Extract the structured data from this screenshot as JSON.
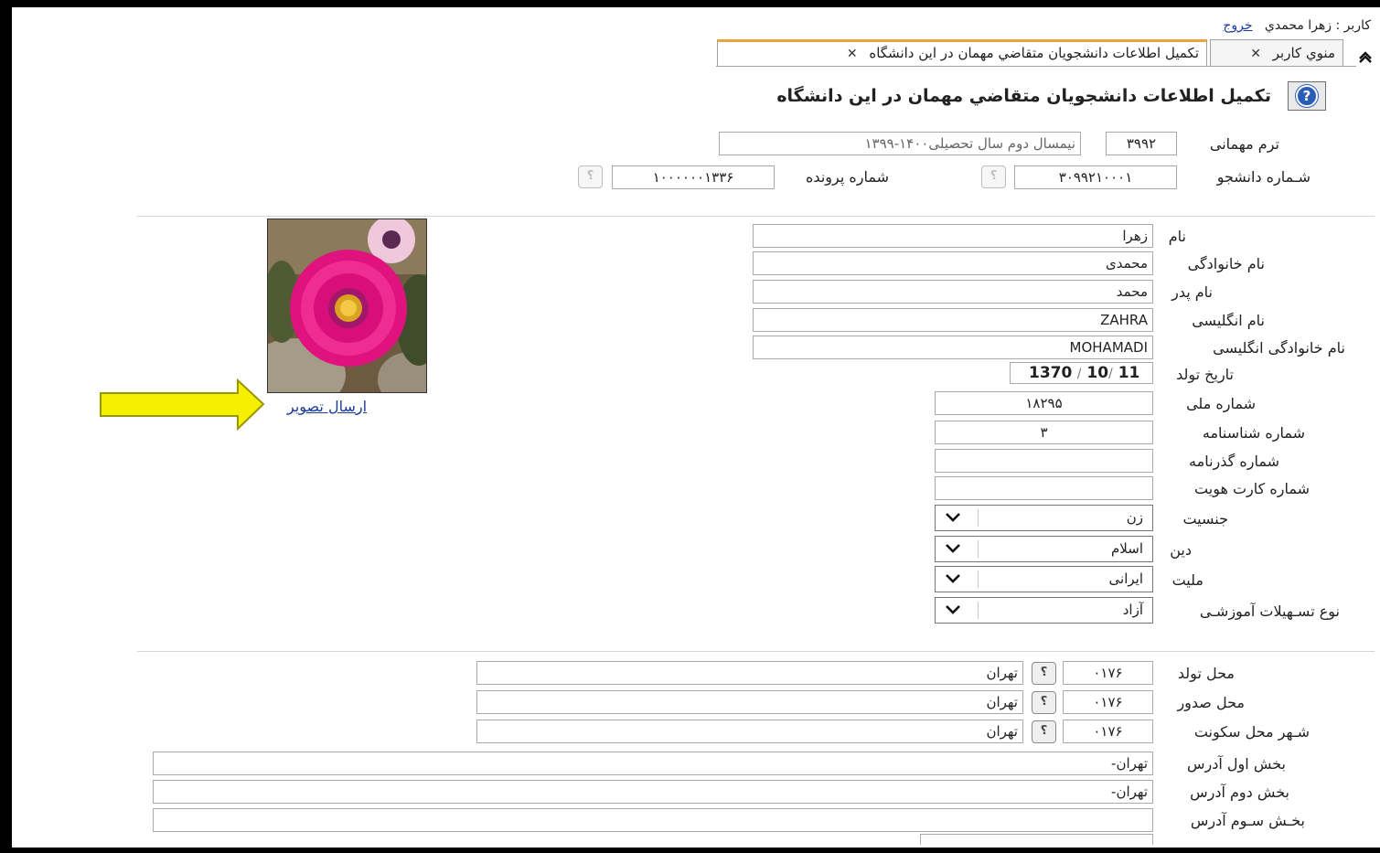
{
  "user": {
    "label": "كاربر : زهرا محمدي",
    "logout": "خروج"
  },
  "tabs": [
    {
      "label": "منوي كاربر",
      "close": "✕"
    },
    {
      "label": "تكميل اطلاعات دانشجويان متقاضي مهمان در اين دانشگاه",
      "close": "✕"
    }
  ],
  "page_title": "تكميل اطلاعات دانشجويان متقاضي مهمان در اين دانشگاه",
  "help_icon": "?",
  "term": {
    "label": "ترم مهمانی",
    "code": "۳۹۹۲",
    "description": "نیمسال  دوم سال تحصیلی۱۴۰۰-۱۳۹۹"
  },
  "student": {
    "label": "شـماره دانشجو",
    "value": "۳۰۹۹۲۱۰۰۰۱"
  },
  "file": {
    "label": "شماره پرونده",
    "value": "۱۰۰۰۰۰۰۱۳۳۶"
  },
  "lookup_glyph": "؟",
  "personal": {
    "first_name": {
      "label": "نام",
      "value": "زهرا"
    },
    "last_name": {
      "label": "نام خانوادگی",
      "value": "محمدی"
    },
    "father_name": {
      "label": "نام پدر",
      "value": "محمد"
    },
    "english_name": {
      "label": "نام انگلیسی",
      "value": "ZAHRA"
    },
    "english_last_name": {
      "label": "نام خانوادگی انگلیسی",
      "value": "MOHAMADI"
    },
    "birth_date": {
      "label": "تاریخ تولد",
      "year": "1370",
      "month": "10",
      "day": "11",
      "sep": "/"
    },
    "national_id": {
      "label": "شماره ملی",
      "value": "۱۸۲۹۵"
    },
    "id_number": {
      "label": "شماره شناسنامه",
      "value": "۳"
    },
    "passport": {
      "label": "شماره گذرنامه",
      "value": ""
    },
    "id_card": {
      "label": "شماره کارت هویت",
      "value": ""
    },
    "gender": {
      "label": "جنسیت",
      "value": "زن"
    },
    "religion": {
      "label": "دین",
      "value": "اسلام"
    },
    "nationality": {
      "label": "ملیت",
      "value": "ایرانی"
    },
    "education_facility": {
      "label": "نوع تسـهیلات آموزشـی",
      "value": "آزاد"
    }
  },
  "photo": {
    "upload_link": "ارسال تصوير"
  },
  "location": {
    "birth_place": {
      "label": "محل تولد",
      "code": "۰۱۷۶",
      "city": "تهران"
    },
    "issue_place": {
      "label": "محل صدور",
      "code": "۰۱۷۶",
      "city": "تهران"
    },
    "residence_city": {
      "label": "شـهر محل سکونت",
      "code": "۰۱۷۶",
      "city": "تهران"
    }
  },
  "address": {
    "part1": {
      "label": "بخش اول آدرس",
      "value": "تهران-"
    },
    "part2": {
      "label": "بخش دوم آدرس",
      "value": "تهران-"
    },
    "part3": {
      "label": "بخـش سـوم آدرس",
      "value": ""
    }
  },
  "colors": {
    "highlight_arrow": "#f5f000",
    "arrow_border": "#9a9600",
    "tab_active_border": "#e8a33d",
    "link": "#1a3a9c"
  }
}
